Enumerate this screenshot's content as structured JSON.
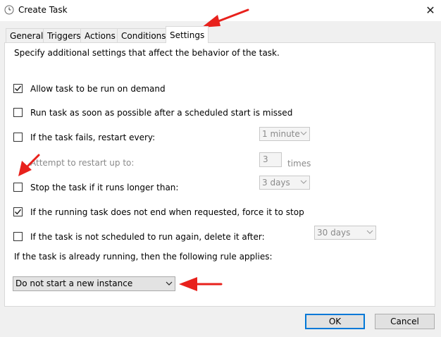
{
  "window": {
    "title": "Create Task",
    "close_glyph": "✕"
  },
  "tabs": [
    {
      "label": "General"
    },
    {
      "label": "Triggers"
    },
    {
      "label": "Actions"
    },
    {
      "label": "Conditions"
    },
    {
      "label": "Settings",
      "active": true
    }
  ],
  "settings": {
    "intro": "Specify additional settings that affect the behavior of the task.",
    "allow_on_demand": {
      "label": "Allow task to be run on demand",
      "checked": true
    },
    "run_asap": {
      "label": "Run task as soon as possible after a scheduled start is missed",
      "checked": false
    },
    "restart_on_fail": {
      "label": "If the task fails, restart every:",
      "checked": false,
      "interval": "1 minute"
    },
    "restart_attempts": {
      "label": "Attempt to restart up to:",
      "value": "3",
      "unit": "times"
    },
    "stop_if_longer": {
      "label": "Stop the task if it runs longer than:",
      "checked": false,
      "duration": "3 days"
    },
    "force_stop": {
      "label": "If the running task does not end when requested, force it to stop",
      "checked": true
    },
    "delete_if_not_scheduled": {
      "label": "If the task is not scheduled to run again, delete it after:",
      "checked": false,
      "after": "30 days"
    },
    "running_rule_label": "If the task is already running, then the following rule applies:",
    "running_rule_value": "Do not start a new instance"
  },
  "buttons": {
    "ok": "OK",
    "cancel": "Cancel"
  },
  "colors": {
    "accent": "#0078d7",
    "annotation_arrow": "#e8211c"
  },
  "icons": {
    "title": "clock-icon",
    "chevron": "chevron-down-icon",
    "check": "checkmark-icon"
  }
}
